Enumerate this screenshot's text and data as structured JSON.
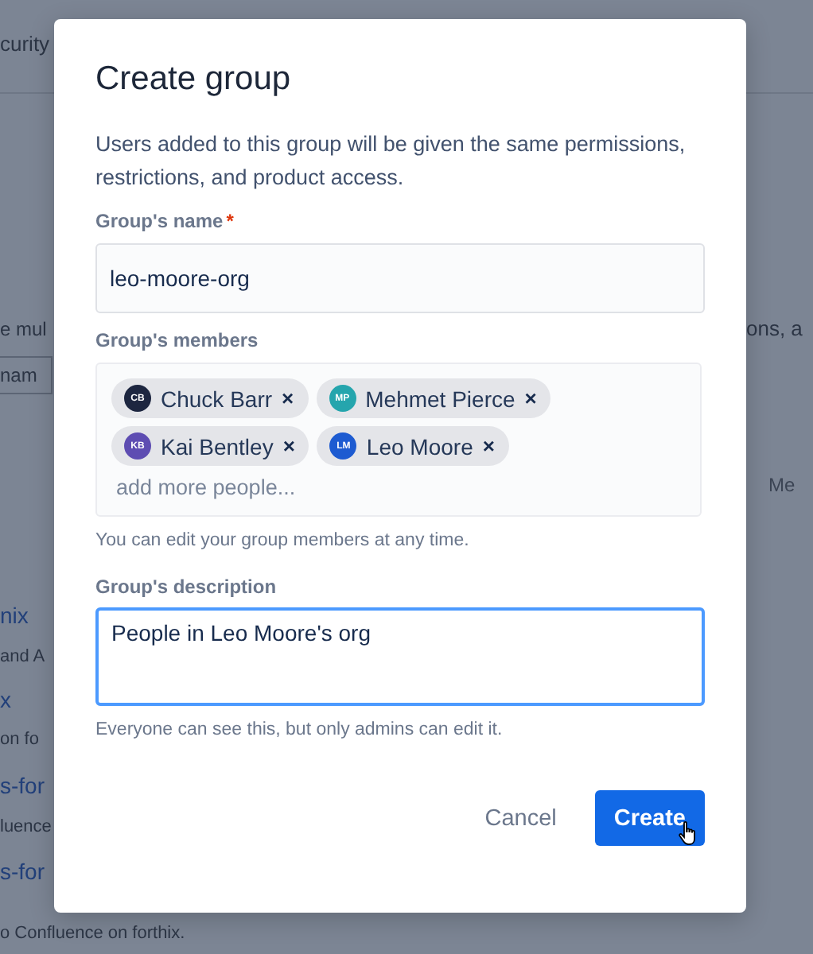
{
  "background": {
    "left": [
      {
        "text": "curity",
        "kind": "tab"
      },
      {
        "text": "e mul",
        "kind": "text"
      },
      {
        "text": "nam",
        "kind": "field"
      },
      {
        "text": "nix",
        "kind": "link"
      },
      {
        "text": "and A",
        "kind": "text"
      },
      {
        "text": "x",
        "kind": "link"
      },
      {
        "text": "on fo",
        "kind": "text"
      },
      {
        "text": "s-for",
        "kind": "link"
      },
      {
        "text": "luence",
        "kind": "text"
      },
      {
        "text": "s-for",
        "kind": "link"
      }
    ],
    "right": [
      {
        "text": "ons, a",
        "kind": "text"
      },
      {
        "text": "Me",
        "kind": "header"
      }
    ],
    "bottom": "o Confluence on forthix."
  },
  "dialog": {
    "title": "Create group",
    "description": "Users added to this group will be given the same permissions, restrictions, and product access.",
    "name_field": {
      "label": "Group's name",
      "required": true,
      "required_mark": "*",
      "value": "leo-moore-org"
    },
    "members": {
      "label": "Group's members",
      "placeholder": "add more people...",
      "hint": "You can edit your group members at any time.",
      "people": [
        {
          "name": "Chuck Barr",
          "initials": "CB",
          "color": "#1d2640",
          "remove": "×"
        },
        {
          "name": "Mehmet Pierce",
          "initials": "MP",
          "color": "#25a5ad",
          "remove": "×"
        },
        {
          "name": "Kai Bentley",
          "initials": "KB",
          "color": "#5e4db2",
          "remove": "×"
        },
        {
          "name": "Leo Moore",
          "initials": "LM",
          "color": "#1d5bd1",
          "remove": "×"
        }
      ]
    },
    "description_field": {
      "label": "Group's description",
      "value": "People in Leo Moore's org",
      "focused": true,
      "hint": "Everyone can see this, but only admins can edit it."
    },
    "buttons": [
      {
        "label": "Cancel",
        "kind": "subtle"
      },
      {
        "label": "Create",
        "kind": "primary",
        "hovered": true
      }
    ]
  }
}
